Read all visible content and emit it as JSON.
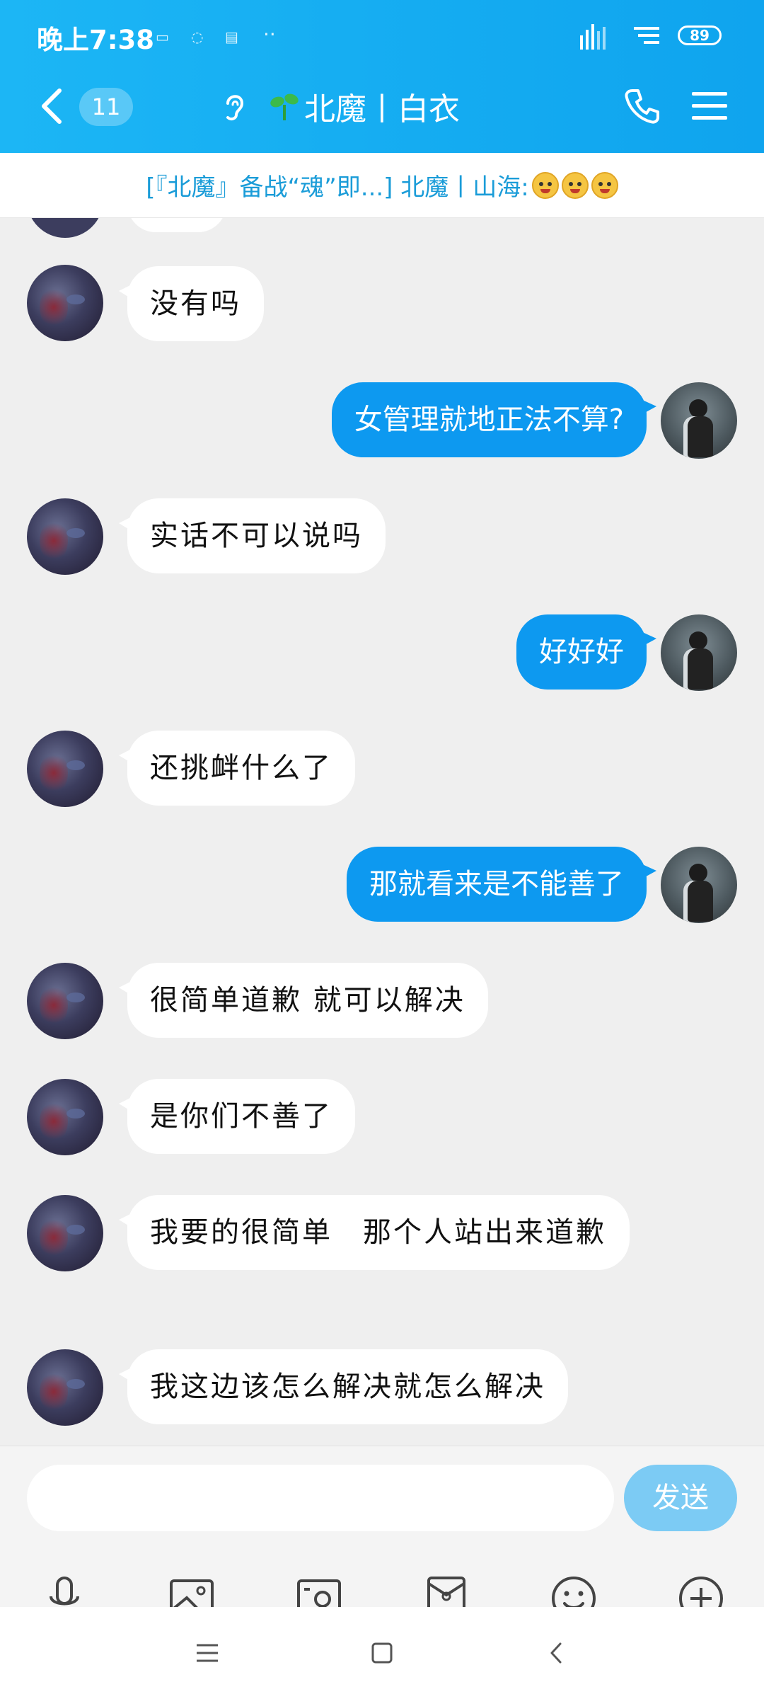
{
  "status_bar": {
    "time": "晚上7:38",
    "battery": "89"
  },
  "header": {
    "unread_count": "11",
    "title": "北魔丨白衣"
  },
  "notice": {
    "text": "[『北魔』备战“魂”即...] 北魔丨山海: "
  },
  "messages": [
    {
      "side": "other",
      "text": "没有吗"
    },
    {
      "side": "self",
      "text": "女管理就地正法不算?"
    },
    {
      "side": "other",
      "text": "实话不可以说吗"
    },
    {
      "side": "self",
      "text": "好好好"
    },
    {
      "side": "other",
      "text": "还挑衅什么了"
    },
    {
      "side": "self",
      "text": "那就看来是不能善了"
    },
    {
      "side": "other",
      "text": "很简单道歉 就可以解决"
    },
    {
      "side": "other",
      "text": "是你们不善了"
    },
    {
      "side": "other",
      "text": "我要的很简单　那个人站出来道歉"
    },
    {
      "side": "other",
      "text": "我这边该怎么解决就怎么解决"
    }
  ],
  "input": {
    "value": "",
    "send_label": "发送"
  },
  "colors": {
    "header": "#1cb6f5",
    "self_bubble": "#0d99f0",
    "send_button": "#7ccbf4"
  },
  "toolbar_icons": [
    "microphone-icon",
    "image-icon",
    "camera-icon",
    "red-packet-icon",
    "emoji-icon",
    "plus-icon"
  ]
}
